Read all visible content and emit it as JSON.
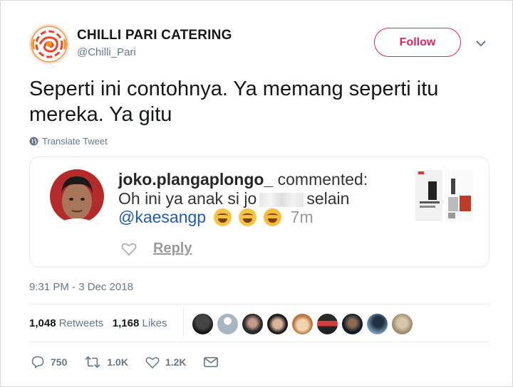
{
  "account": {
    "display_name": "CHILLI PARI CATERING",
    "handle": "@Chilli_Pari",
    "follow_label": "Follow"
  },
  "tweet": {
    "text": "Seperti ini contohnya. Ya memang seperti itu mereka. Ya gitu",
    "translate_label": "Translate Tweet",
    "timestamp": "9:31 PM - 3 Dec 2018"
  },
  "quoted_comment": {
    "username": "joko.plangaplongo_",
    "action": " commented:",
    "text_before": "Oh ini ya anak si jo",
    "text_after": "selain",
    "mention": "@kaesangp",
    "age": "7m",
    "reply_label": "Reply"
  },
  "stats": {
    "retweets_count": "1,048",
    "retweets_label": "Retweets",
    "likes_count": "1,168",
    "likes_label": "Likes"
  },
  "actions": {
    "replies": "750",
    "retweets": "1.0K",
    "likes": "1.2K"
  },
  "colors": {
    "accent": "#e0245e",
    "muted": "#657786",
    "link": "#1f5bb5",
    "border": "#e1e8ed"
  }
}
